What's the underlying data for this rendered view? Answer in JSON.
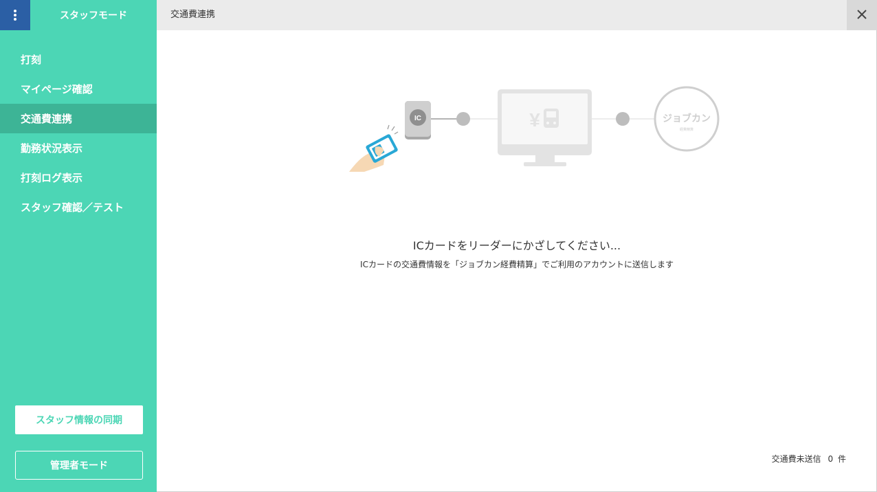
{
  "sidebar": {
    "mode_title": "スタッフモード",
    "menu_icon": "kebab-menu-icon",
    "items": [
      {
        "label": "打刻",
        "active": false
      },
      {
        "label": "マイページ確認",
        "active": false
      },
      {
        "label": "交通費連携",
        "active": true
      },
      {
        "label": "勤務状況表示",
        "active": false
      },
      {
        "label": "打刻ログ表示",
        "active": false
      },
      {
        "label": "スタッフ確認／テスト",
        "active": false
      }
    ],
    "sync_label": "スタッフ情報の同期",
    "admin_label": "管理者モード"
  },
  "header": {
    "title": "交通費連携",
    "close_icon": "close-icon"
  },
  "illustration": {
    "reader_label": "IC",
    "card_label": "IC",
    "monitor_symbols": "¥",
    "service_logo": "ジョブカン",
    "service_sub": "経費精算"
  },
  "main": {
    "message": "ICカードをリーダーにかざしてください...",
    "sub_message": "ICカードの交通費情報を「ジョブカン経費精算」でご利用のアカウントに送信します"
  },
  "footer": {
    "pending_label": "交通費未送信",
    "pending_count": "0",
    "pending_unit": "件"
  },
  "colors": {
    "sidebar": "#4cd6b5",
    "sidebar_active": "#3db496",
    "menu_button": "#2b5fa5",
    "card": "#29a8d6"
  }
}
